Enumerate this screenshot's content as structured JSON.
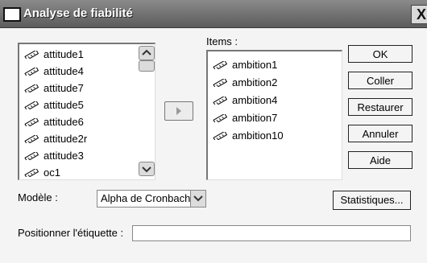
{
  "window": {
    "title": "Analyse de fiabilité",
    "close_glyph": "X"
  },
  "variables_list": {
    "items": [
      {
        "label": "attitude1",
        "icon": "ruler-icon"
      },
      {
        "label": "attitude4",
        "icon": "ruler-icon"
      },
      {
        "label": "attitude7",
        "icon": "ruler-icon"
      },
      {
        "label": "attitude5",
        "icon": "ruler-icon"
      },
      {
        "label": "attitude6",
        "icon": "ruler-icon"
      },
      {
        "label": "attitude2r",
        "icon": "ruler-icon"
      },
      {
        "label": "attitude3",
        "icon": "ruler-icon"
      },
      {
        "label": "oc1",
        "icon": "ruler-icon"
      }
    ]
  },
  "items_list": {
    "label": "Items :",
    "items": [
      {
        "label": "ambition1",
        "icon": "ruler-icon"
      },
      {
        "label": "ambition2",
        "icon": "ruler-icon"
      },
      {
        "label": "ambition4",
        "icon": "ruler-icon"
      },
      {
        "label": "ambition7",
        "icon": "ruler-icon"
      },
      {
        "label": "ambition10",
        "icon": "ruler-icon"
      }
    ]
  },
  "buttons": {
    "ok": "OK",
    "paste": "Coller",
    "reset": "Restaurer",
    "cancel": "Annuler",
    "help": "Aide",
    "statistics": "Statistiques..."
  },
  "model": {
    "label": "Modèle :",
    "selected": "Alpha de Cronbach"
  },
  "label_field": {
    "label": "Positionner l'étiquette :",
    "value": ""
  },
  "colors": {
    "titlebar": "#5c5c5c",
    "window_bg": "#f4f4f4"
  }
}
